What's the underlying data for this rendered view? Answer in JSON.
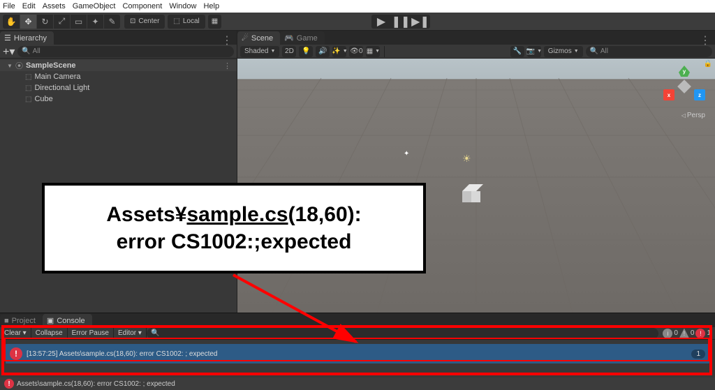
{
  "menu": {
    "items": [
      "File",
      "Edit",
      "Assets",
      "GameObject",
      "Component",
      "Window",
      "Help"
    ]
  },
  "toolbar": {
    "pivot": "Center",
    "local": "Local"
  },
  "hierarchy": {
    "title": "Hierarchy",
    "search_placeholder": "All",
    "scene": "SampleScene",
    "items": [
      "Main Camera",
      "Directional Light",
      "Cube"
    ]
  },
  "scene": {
    "tab_scene": "Scene",
    "tab_game": "Game",
    "shaded": "Shaded",
    "mode2d": "2D",
    "gizmos": "Gizmos",
    "search_placeholder": "All",
    "persp": "Persp",
    "axis_x": "x",
    "axis_y": "y",
    "axis_z": "z"
  },
  "bottom": {
    "tab_project": "Project",
    "tab_console": "Console",
    "clear": "Clear",
    "collapse": "Collapse",
    "error_pause": "Error Pause",
    "editor": "Editor",
    "counts": {
      "info": "0",
      "warn": "0",
      "err": "1"
    },
    "row": {
      "text": "[13:57:25] Assets\\sample.cs(18,60): error CS1002: ; expected",
      "count": "1"
    }
  },
  "status": {
    "text": "Assets\\sample.cs(18,60): error CS1002: ; expected"
  },
  "callout": {
    "line1_a": "Assets¥",
    "line1_u": "sample.cs",
    "line1_b": "(18,60):",
    "line2": "error CS1002:;expected"
  }
}
